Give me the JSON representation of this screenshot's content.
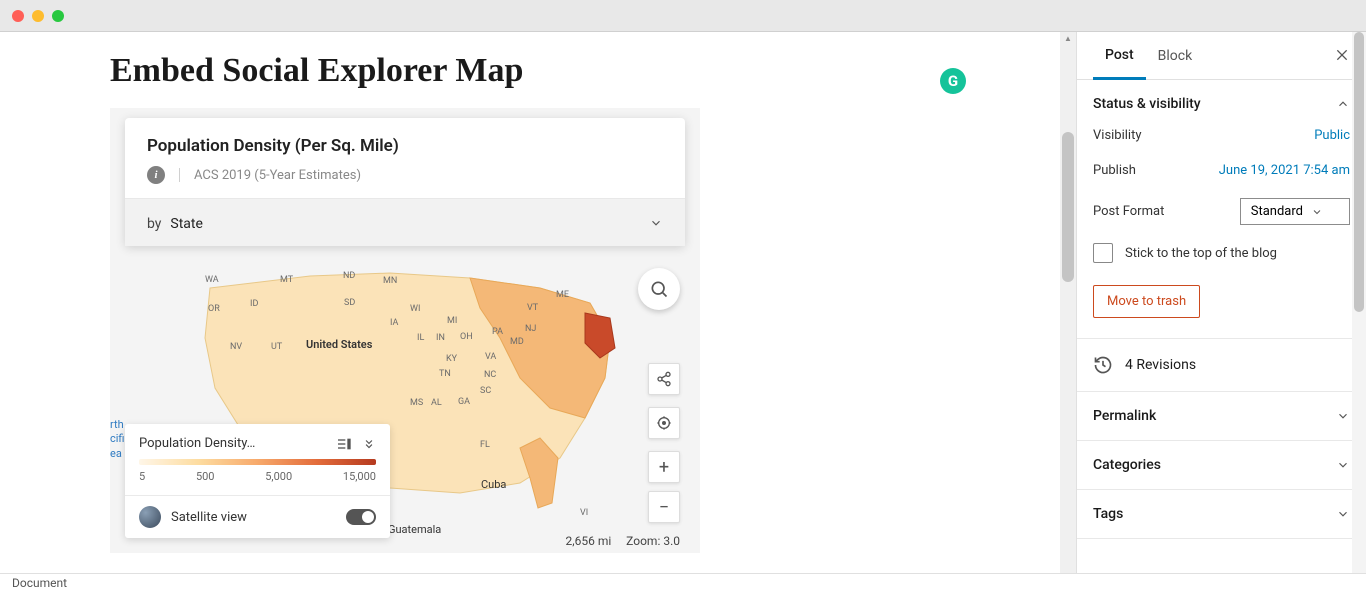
{
  "page": {
    "title": "Embed Social Explorer Map"
  },
  "grammarly_glyph": "G",
  "map": {
    "info": {
      "title": "Population Density (Per Sq. Mile)",
      "source": "ACS 2019 (5-Year Estimates)",
      "by_prefix": "by",
      "by_value": "State"
    },
    "legend": {
      "title": "Population Density…",
      "ticks": [
        "5",
        "500",
        "5,000",
        "15,000"
      ],
      "satellite_label": "Satellite view"
    },
    "footer": {
      "distance": "2,656 mi",
      "zoom_label": "Zoom:",
      "zoom_value": "3.0"
    },
    "states": [
      "WA",
      "MT",
      "ND",
      "MN",
      "OR",
      "ID",
      "SD",
      "WI",
      "ME",
      "NV",
      "UT",
      "IA",
      "MI",
      "IL",
      "IN",
      "OH",
      "PA",
      "KY",
      "NC",
      "TN",
      "GA",
      "SC",
      "AL",
      "MS",
      "FL",
      "VA",
      "MD",
      "NJ",
      "VT",
      "VI"
    ],
    "countries": {
      "us": "United States",
      "cuba": "Cuba",
      "guatemala": "Guatemala"
    },
    "pacific": {
      "l1": "rth",
      "l2": "cifi",
      "l3": "ea"
    }
  },
  "sidebar": {
    "tabs": {
      "post": "Post",
      "block": "Block"
    },
    "panels": {
      "status_vis": "Status & visibility",
      "visibility_label": "Visibility",
      "visibility_value": "Public",
      "publish_label": "Publish",
      "publish_value": "June 19, 2021 7:54 am",
      "format_label": "Post Format",
      "format_value": "Standard",
      "stick_label": "Stick to the top of the blog",
      "trash": "Move to trash",
      "revisions": "4 Revisions",
      "permalink": "Permalink",
      "categories": "Categories",
      "tags": "Tags"
    }
  },
  "status_bar": "Document"
}
